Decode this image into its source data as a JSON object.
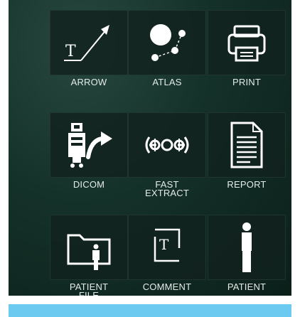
{
  "tiles": [
    {
      "label": "ARROW",
      "icon": "arrow-icon"
    },
    {
      "label": "ATLAS",
      "icon": "atlas-icon"
    },
    {
      "label": "PRINT",
      "icon": "printer-icon"
    },
    {
      "label": "DICOM",
      "icon": "dicom-export-icon"
    },
    {
      "label": "FAST\nEXTRACT",
      "icon": "fast-extract-icon"
    },
    {
      "label": "REPORT",
      "icon": "report-icon"
    },
    {
      "label": "PATIENT\nFILE",
      "icon": "patient-file-icon"
    },
    {
      "label": "COMMENT",
      "icon": "comment-icon"
    },
    {
      "label": "PATIENT",
      "icon": "patient-icon"
    }
  ],
  "colors": {
    "panel_background": "#143129",
    "tile_background": "#12221e",
    "icon": "#ffffff",
    "label_text": "#e4ebe8",
    "accent_bar": "#6ccaf0"
  }
}
